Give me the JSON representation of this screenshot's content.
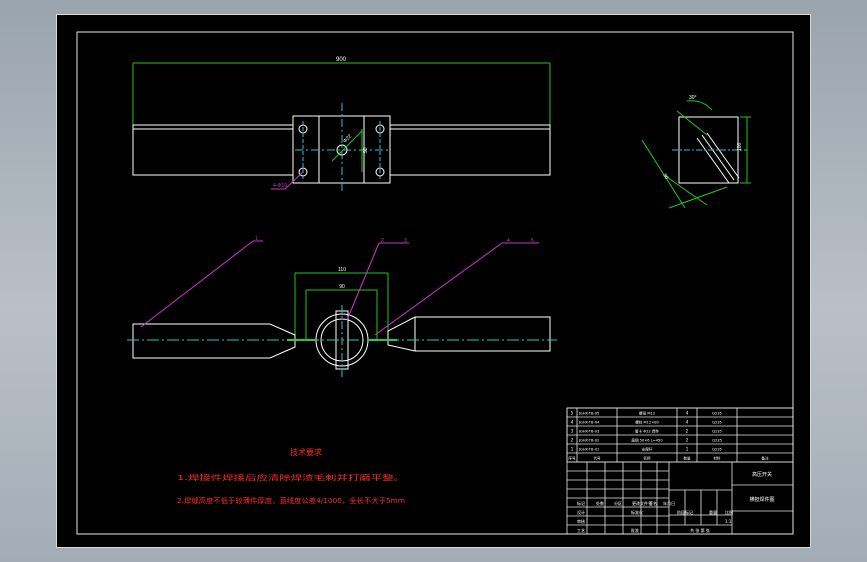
{
  "window": {
    "title": "Engineering drawing viewer"
  },
  "dimensions": {
    "overall_length": "900",
    "hole_spacing": "90",
    "width_110": "110",
    "width_90": "90",
    "dia_label": "Φ22",
    "small_holes": "4-Φ10",
    "angle": "30°",
    "side_1": "80",
    "side_2": "100"
  },
  "balloons": [
    "1",
    "2",
    "3",
    "4",
    "5"
  ],
  "notes": {
    "heading": "技术要求",
    "line1": "1.焊接件焊接后应清除焊渣毛刺并打磨平整。",
    "line2": "2.焊缝高度不低于较薄件厚度，直线度公差4/1000，全长不大于5mm"
  },
  "bom": {
    "rows": [
      {
        "no": "5",
        "code": "JGHX-TB-05",
        "name": "螺母 M12",
        "qty": "4",
        "material": "Q235",
        "note": ""
      },
      {
        "no": "4",
        "code": "JGHX-TB-04",
        "name": "螺栓 M12×80",
        "qty": "4",
        "material": "Q235",
        "note": ""
      },
      {
        "no": "3",
        "code": "JGHX-TB-03",
        "name": "管卡 Φ22 焊件",
        "qty": "2",
        "material": "Q235",
        "note": ""
      },
      {
        "no": "2",
        "code": "JGHX-TB-02",
        "name": "扁钢 50×6 L=450",
        "qty": "2",
        "material": "Q235",
        "note": ""
      },
      {
        "no": "1",
        "code": "JGHX-TB-01",
        "name": "支撑杆",
        "qty": "1",
        "material": "Q235",
        "note": ""
      }
    ],
    "header": {
      "no": "序号",
      "code": "代号",
      "name": "名称",
      "qty": "数量",
      "material": "材料",
      "note": "备注"
    }
  },
  "title_block": {
    "part_name": "高压开关",
    "drawing_name": "横担焊件图",
    "labels": {
      "mark": "标记",
      "count": "处数",
      "zone": "分区",
      "change": "更改文件号",
      "sign": "签名",
      "date": "年月日",
      "design": "设计",
      "standard": "标准化",
      "stage": "阶段标记",
      "weight": "重量",
      "scale": "比例",
      "check": "审核",
      "process": "工艺",
      "approve": "批准",
      "sheet": "共 张 第 张",
      "scale_value": "1:1"
    }
  }
}
